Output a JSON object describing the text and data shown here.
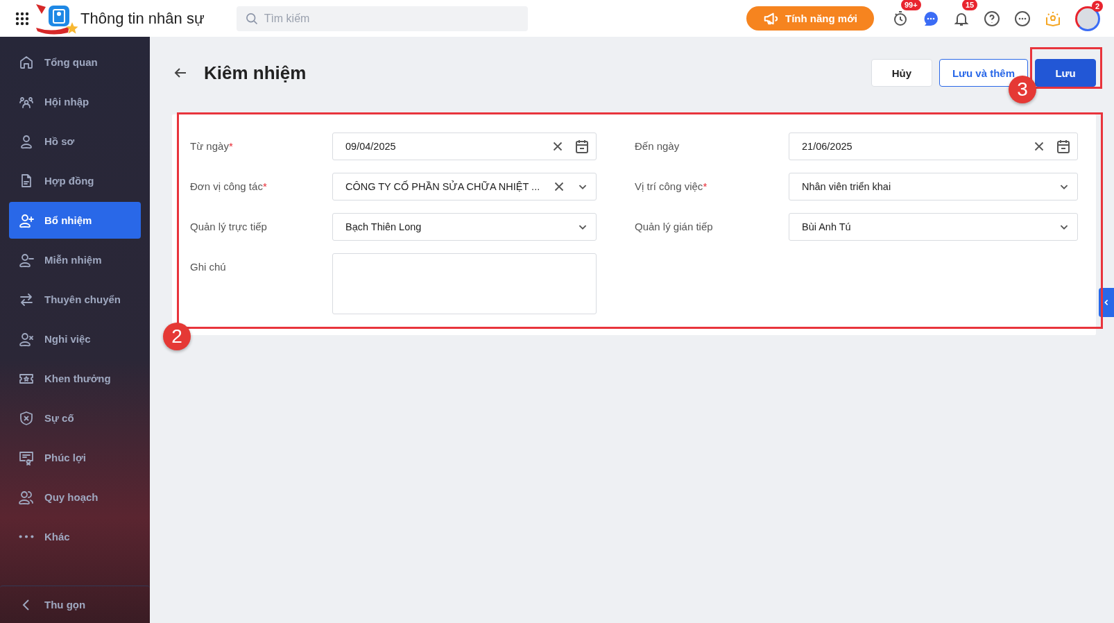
{
  "app": {
    "title": "Thông tin nhân sự",
    "search": {
      "placeholder": "Tìm kiếm"
    },
    "new_features_button": "Tính năng mới",
    "timer_badge": "99+",
    "notification_badge": "15",
    "avatar_badge": "2"
  },
  "sidebar": {
    "items": [
      {
        "label": "Tổng quan",
        "selected": false
      },
      {
        "label": "Hội nhập",
        "selected": false
      },
      {
        "label": "Hồ sơ",
        "selected": false
      },
      {
        "label": "Hợp đồng",
        "selected": false
      },
      {
        "label": "Bổ nhiệm",
        "selected": true
      },
      {
        "label": "Miễn nhiệm",
        "selected": false
      },
      {
        "label": "Thuyên chuyển",
        "selected": false
      },
      {
        "label": "Nghỉ việc",
        "selected": false
      },
      {
        "label": "Khen thưởng",
        "selected": false
      },
      {
        "label": "Sự cố",
        "selected": false
      },
      {
        "label": "Phúc lợi",
        "selected": false
      },
      {
        "label": "Quy hoạch",
        "selected": false
      },
      {
        "label": "Khác",
        "selected": false
      }
    ],
    "collapse": "Thu gọn"
  },
  "page": {
    "title": "Kiêm nhiệm",
    "buttons": [
      {
        "label": "Hủy",
        "kind": "default"
      },
      {
        "label": "Lưu và thêm",
        "kind": "outline"
      },
      {
        "label": "Lưu",
        "kind": "primary"
      }
    ]
  },
  "form": {
    "required_mark": "*",
    "fields": [
      {
        "label": "Từ ngày",
        "required": true,
        "kind": "date",
        "value": "09/04/2025",
        "clearable": true
      },
      {
        "label": "Đến ngày",
        "required": false,
        "kind": "date",
        "value": "21/06/2025",
        "clearable": true
      },
      {
        "label": "Đơn vị công tác",
        "required": true,
        "kind": "select",
        "value": "CÔNG TY CỐ PHẦN SỬA CHỮA NHIỆT ...",
        "clearable": true
      },
      {
        "label": "Vị trí công việc",
        "required": true,
        "kind": "select",
        "value": "Nhân viên triển khai",
        "clearable": false
      },
      {
        "label": "Quản lý trực tiếp",
        "required": false,
        "kind": "select",
        "value": "Bạch Thiên Long",
        "clearable": false
      },
      {
        "label": "Quản lý gián tiếp",
        "required": false,
        "kind": "select",
        "value": "Bùi Anh Tú",
        "clearable": false
      },
      {
        "label": "Ghi chú",
        "required": false,
        "kind": "textarea"
      }
    ]
  },
  "annotations": [
    {
      "number": "2"
    },
    {
      "number": "3"
    }
  ]
}
